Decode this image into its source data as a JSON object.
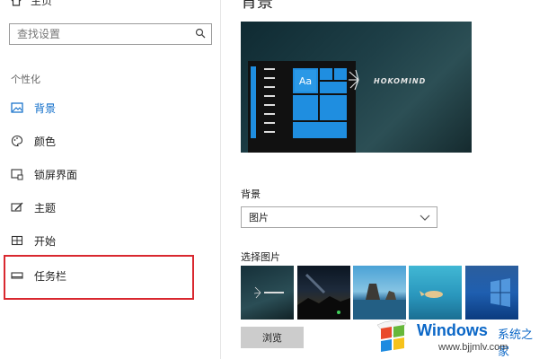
{
  "sidebar": {
    "home_label": "主页",
    "search_placeholder": "查找设置",
    "section_title": "个性化",
    "items": [
      {
        "label": "背景",
        "icon": "picture-icon",
        "active": true
      },
      {
        "label": "颜色",
        "icon": "palette-icon",
        "active": false
      },
      {
        "label": "锁屏界面",
        "icon": "lock-screen-icon",
        "active": false
      },
      {
        "label": "主题",
        "icon": "theme-icon",
        "active": false
      },
      {
        "label": "开始",
        "icon": "start-icon",
        "active": false
      },
      {
        "label": "任务栏",
        "icon": "taskbar-icon",
        "active": false
      }
    ]
  },
  "main": {
    "title": "背景",
    "preview": {
      "tile_text": "Aa",
      "brand_text": "HOKOMIND"
    },
    "background_label": "背景",
    "background_value": "图片",
    "choose_label": "选择图片",
    "browse_label": "浏览"
  },
  "watermark": {
    "brand": "Windows",
    "cn": "系统之家",
    "url": "www.bjjmlv.com"
  },
  "colors": {
    "accent": "#0a6ac8",
    "highlight": "#d9282f",
    "tile": "#1f8ee0"
  }
}
